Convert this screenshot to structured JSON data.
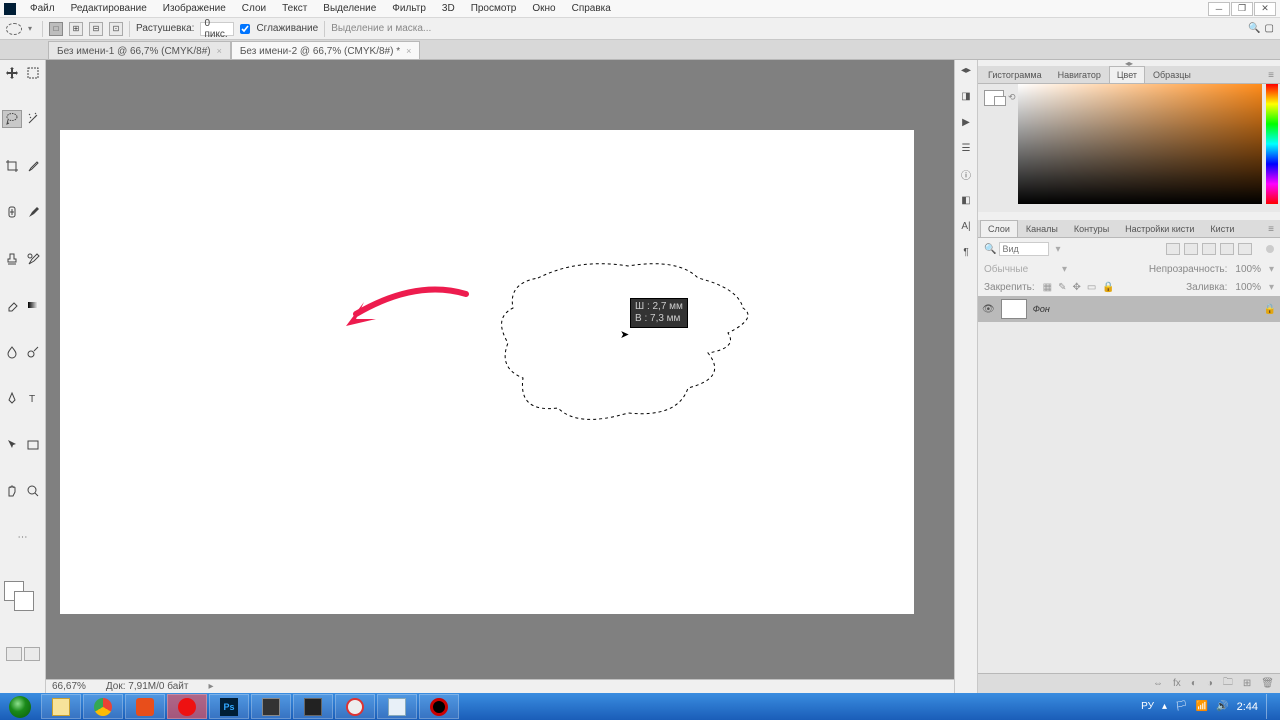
{
  "menu": {
    "items": [
      "Файл",
      "Редактирование",
      "Изображение",
      "Слои",
      "Текст",
      "Выделение",
      "Фильтр",
      "3D",
      "Просмотр",
      "Окно",
      "Справка"
    ]
  },
  "options": {
    "sel_modes": [
      "□",
      "⊞",
      "⊟",
      "⊡"
    ],
    "feather_label": "Растушевка:",
    "feather_value": "0 пикс.",
    "anti_alias": "Сглаживание",
    "refine": "Выделение и маска..."
  },
  "tabs": [
    {
      "label": "Без имени-1 @ 66,7% (CMYK/8#)"
    },
    {
      "label": "Без имени-2 @ 66,7% (CMYK/8#) *"
    }
  ],
  "status": {
    "zoom": "66,67%",
    "doc": "Док: 7,91M/0 байт"
  },
  "tooltip": {
    "w": "Ш : 2,7 мм",
    "h": "В : 7,3 мм"
  },
  "right": {
    "color_tabs": [
      "Гистограмма",
      "Навигатор",
      "Цвет",
      "Образцы"
    ],
    "color_active": 2,
    "layer_tabs": [
      "Слои",
      "Каналы",
      "Контуры",
      "Настройки кисти",
      "Кисти"
    ],
    "layer_active": 0,
    "search_placeholder": "Вид",
    "blend": "Обычные",
    "opacity_label": "Непрозрачность:",
    "opacity_val": "100%",
    "lock_label": "Закрепить:",
    "fill_label": "Заливка:",
    "fill_val": "100%",
    "layer_name": "Фон"
  },
  "tray": {
    "lang": "РУ",
    "time": "2:44"
  }
}
